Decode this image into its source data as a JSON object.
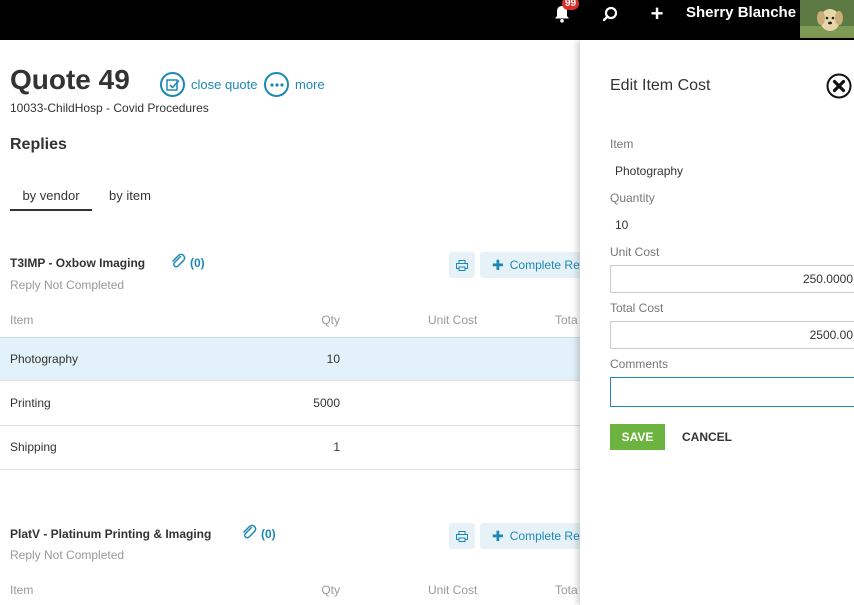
{
  "topbar": {
    "notification_count": "99",
    "user_name": "Sherry Blanche",
    "plus_label": "+"
  },
  "page": {
    "title": "Quote 49",
    "close_quote_label": "close quote",
    "more_label": "more",
    "subtitle": "10033-ChildHosp - Covid Procedures",
    "replies_heading": "Replies",
    "tabs": [
      {
        "label": "by vendor",
        "active": true
      },
      {
        "label": "by item",
        "active": false
      }
    ]
  },
  "vendors": [
    {
      "name": "T3IMP - Oxbow Imaging",
      "attachments": "(0)",
      "status": "Reply Not Completed",
      "complete_label": "Complete Re",
      "columns": {
        "item": "Item",
        "qty": "Qty",
        "unit_cost": "Unit Cost",
        "total": "Tota"
      },
      "rows": [
        {
          "item": "Photography",
          "qty": "10"
        },
        {
          "item": "Printing",
          "qty": "5000"
        },
        {
          "item": "Shipping",
          "qty": "1"
        }
      ]
    },
    {
      "name": "PlatV - Platinum Printing & Imaging",
      "attachments": "(0)",
      "status": "Reply Not Completed",
      "complete_label": "Complete Re",
      "columns": {
        "item": "Item",
        "qty": "Qty",
        "unit_cost": "Unit Cost",
        "total": "Tota"
      }
    }
  ],
  "panel": {
    "title": "Edit Item Cost",
    "item_label": "Item",
    "item_value": "Photography",
    "quantity_label": "Quantity",
    "quantity_value": "10",
    "unit_cost_label": "Unit Cost",
    "unit_cost_value": "250.0000",
    "total_cost_label": "Total Cost",
    "total_cost_value": "2500.00",
    "comments_label": "Comments",
    "comments_value": "",
    "save_label": "SAVE",
    "cancel_label": "CANCEL"
  },
  "colors": {
    "accent": "#1e88b5",
    "save": "#6db33f",
    "badge": "#d9302c",
    "selected_row": "#e3f1fa"
  }
}
